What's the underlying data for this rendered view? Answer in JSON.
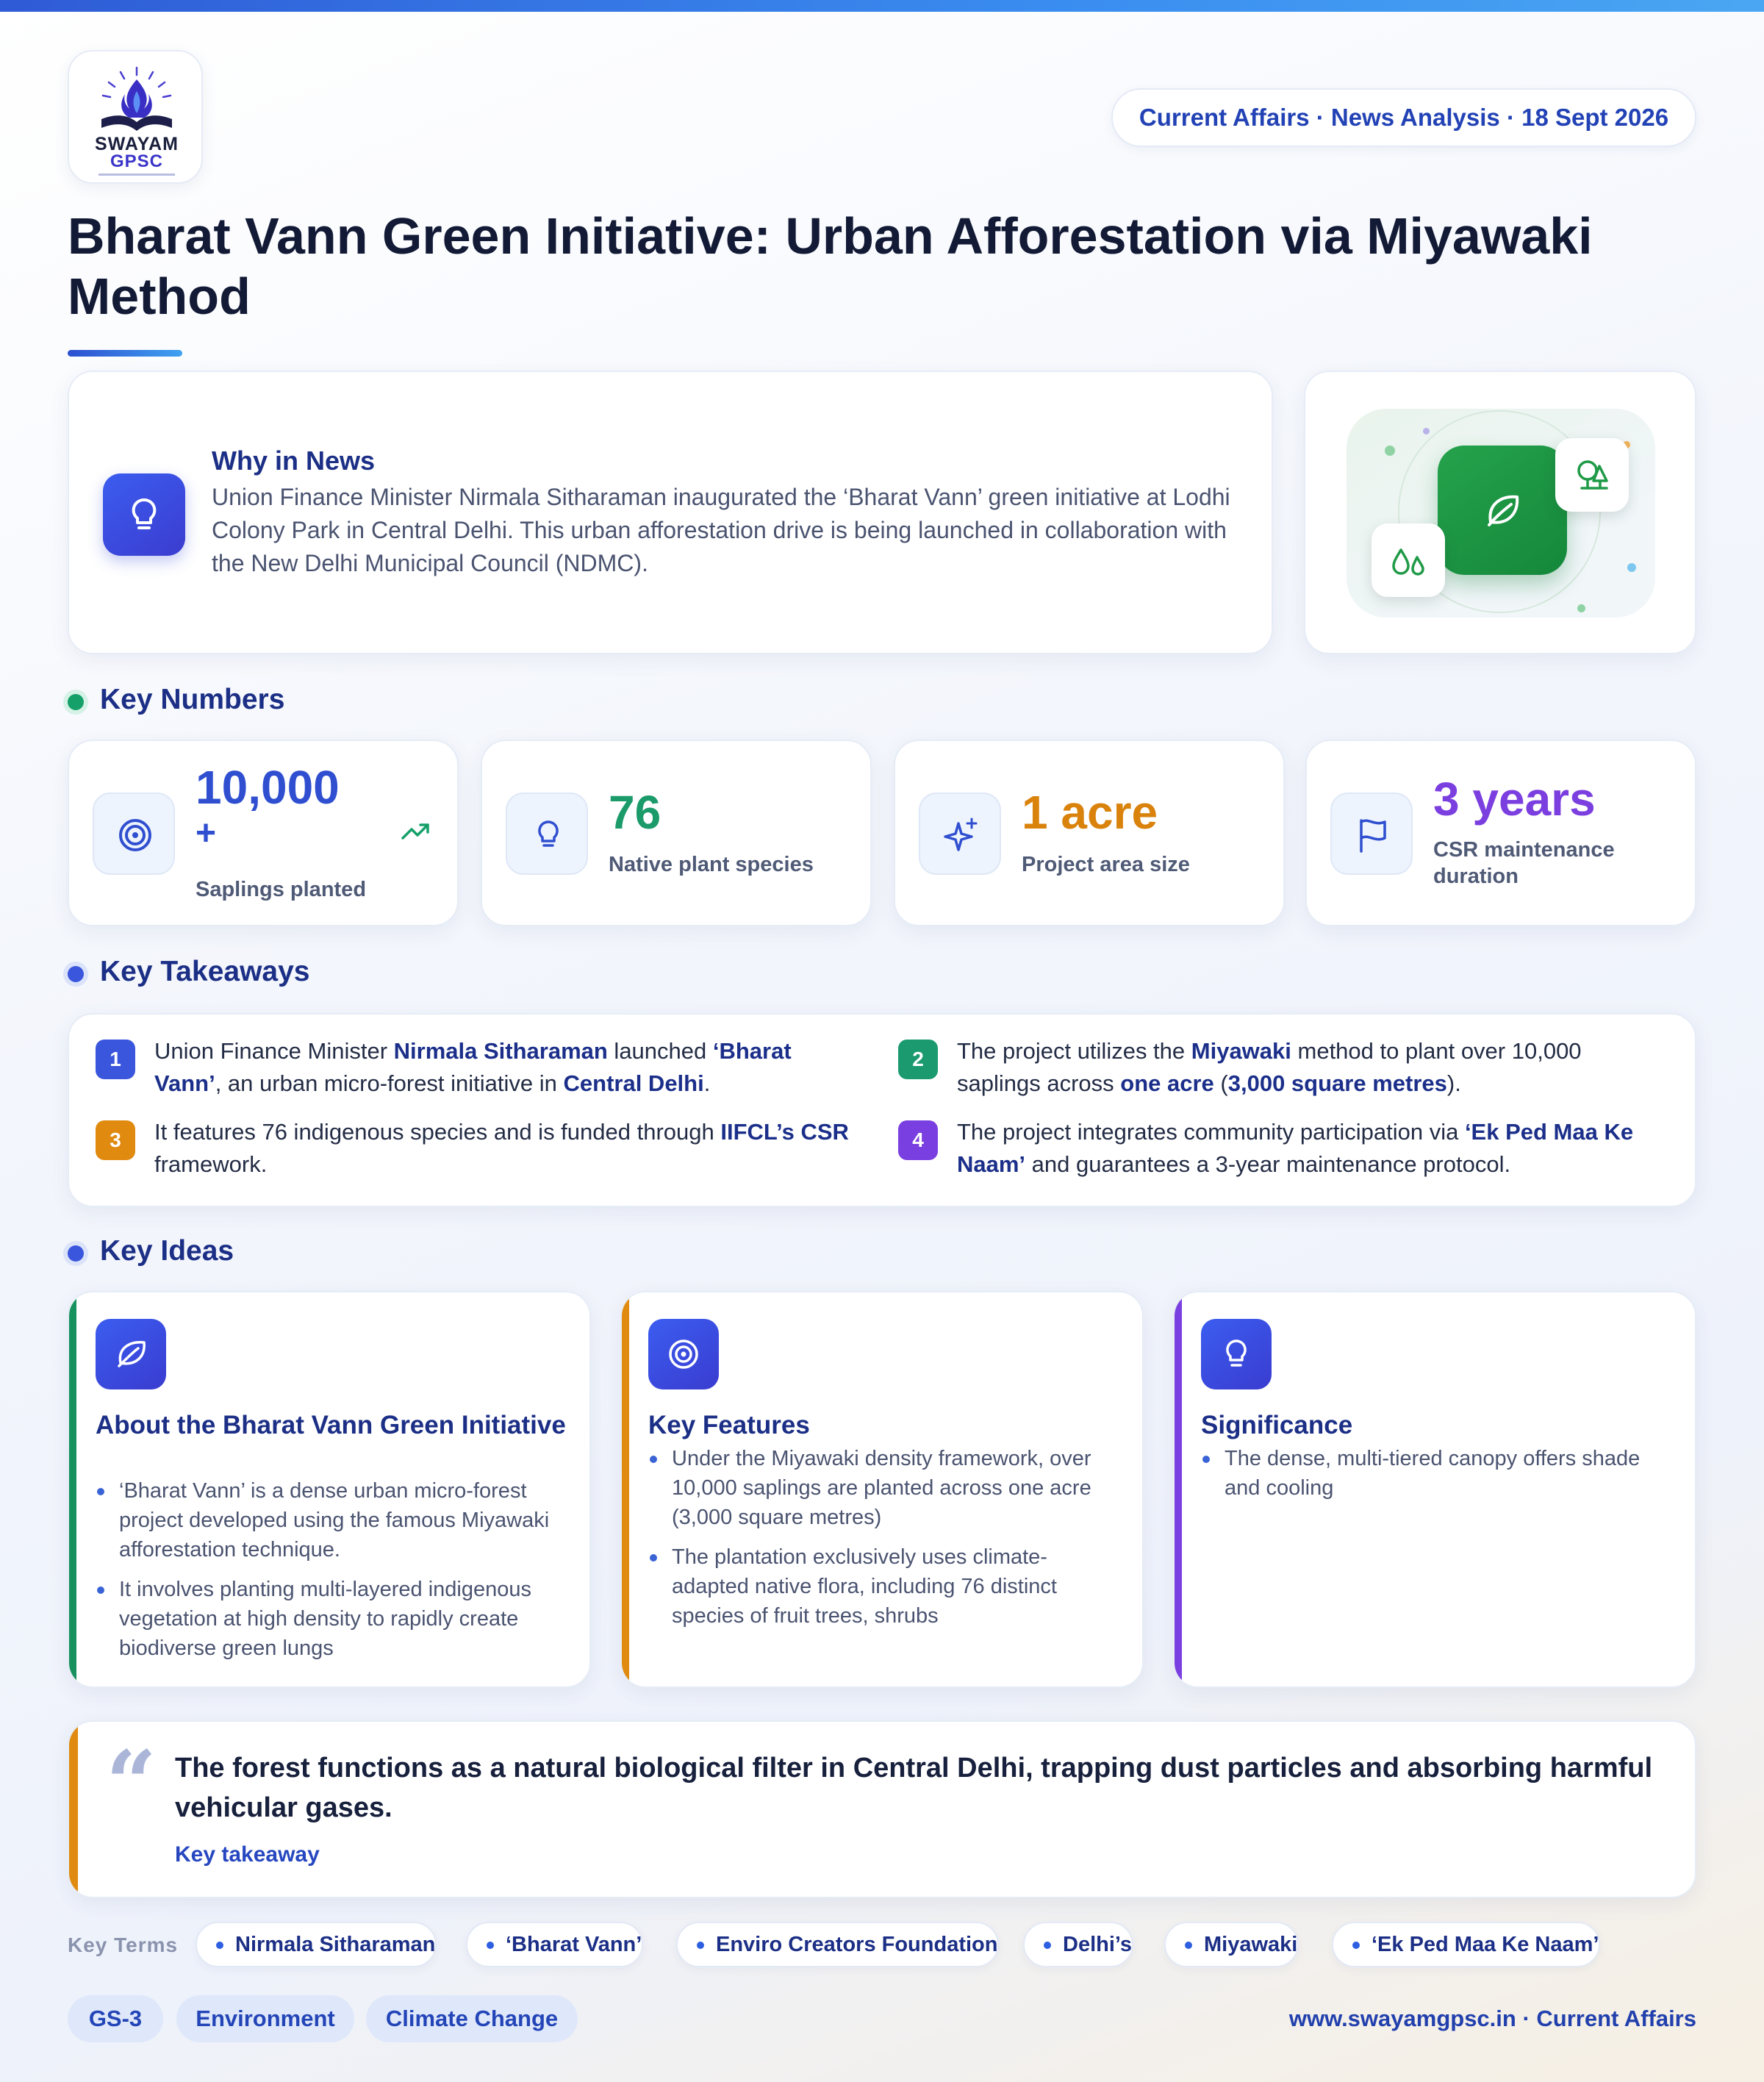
{
  "brand": {
    "line1": "SWAYAM",
    "line2": "GPSC",
    "logo_icon": "book-flame-logo-icon"
  },
  "header": {
    "date_pill": "Current Affairs · News Analysis · 18 Sept 2026",
    "title": "Bharat Vann Green Initiative: Urban Afforestation via Miyawaki Method"
  },
  "why_in_news": {
    "heading": "Why in News",
    "text": "Union Finance Minister Nirmala Sitharaman inaugurated the ‘Bharat Vann’ green initiative at Lodhi Colony Park in Central Delhi. This urban afforestation drive is being launched in collaboration with the New Delhi Municipal Council (NDMC).",
    "icon": "lightbulb-icon"
  },
  "hero": {
    "main_icon": "leaf-icon",
    "chip_icons": [
      "trees-icon",
      "droplets-icon"
    ],
    "accent": "#1f9a47"
  },
  "key_numbers": {
    "heading": "Key Numbers",
    "items": [
      {
        "value": "10,000",
        "value_suffix": "+",
        "label": "Saplings planted",
        "icon": "target-icon",
        "trend_icon": "trending-up-icon",
        "color": "#2f4fd0"
      },
      {
        "value": "76",
        "label": "Native plant species",
        "icon": "lightbulb-icon",
        "color": "#1b9a6a"
      },
      {
        "value": "1 acre",
        "label": "Project area size",
        "icon": "sparkles-icon",
        "color": "#d9820c"
      },
      {
        "value": "3 years",
        "label_line1": "CSR maintenance",
        "label_line2": "duration",
        "icon": "flag-icon",
        "color": "#7b3fe0"
      }
    ]
  },
  "key_takeaways": {
    "heading": "Key Takeaways",
    "items": [
      {
        "num": "1",
        "color": "#3a56dd",
        "parts": [
          [
            "Union Finance Minister ",
            false
          ],
          [
            "Nirmala Sitharaman",
            true
          ],
          [
            " launched ",
            false
          ],
          [
            "‘Bharat Vann’",
            true
          ],
          [
            ", an urban micro-forest initiative in ",
            false
          ],
          [
            "Central Delhi",
            true
          ],
          [
            ".",
            false
          ]
        ]
      },
      {
        "num": "2",
        "color": "#1a9a6e",
        "parts": [
          [
            "The project utilizes the ",
            false
          ],
          [
            "Miyawaki",
            true
          ],
          [
            " method to plant over 10,000 saplings across ",
            false
          ],
          [
            "one acre",
            true
          ],
          [
            " (",
            false
          ],
          [
            "3,000 square metres",
            true
          ],
          [
            ").",
            false
          ]
        ]
      },
      {
        "num": "3",
        "color": "#e08a10",
        "parts": [
          [
            "It features 76 indigenous species and is funded through ",
            false
          ],
          [
            "IIFCL’s CSR",
            true
          ],
          [
            " framework.",
            false
          ]
        ]
      },
      {
        "num": "4",
        "color": "#7a3fe0",
        "parts": [
          [
            "The project integrates community participation via ",
            false
          ],
          [
            "‘Ek Ped Maa Ke Naam’",
            true
          ],
          [
            " and guarantees a 3-year maintenance protocol.",
            false
          ]
        ]
      }
    ]
  },
  "key_ideas": {
    "heading": "Key Ideas",
    "cards": [
      {
        "title": "About the Bharat Vann Green Initiative",
        "icon": "leaf-icon",
        "edge": "#17915d",
        "points": [
          "‘Bharat Vann’ is a dense urban micro-forest project developed using the famous Miyawaki afforestation technique.",
          "It involves planting multi-layered indigenous vegetation at high density to rapidly create biodiverse green lungs"
        ]
      },
      {
        "title": "Key Features",
        "icon": "target-icon",
        "edge": "#e08a10",
        "points": [
          "Under the Miyawaki density framework, over 10,000 saplings are planted across one acre (3,000 square metres)",
          "The plantation exclusively uses climate-adapted native flora, including 76 distinct species of fruit trees, shrubs"
        ]
      },
      {
        "title": "Significance",
        "icon": "lightbulb-icon",
        "edge": "#7a3fe0",
        "points": [
          "The dense, multi-tiered canopy offers shade and cooling"
        ]
      }
    ]
  },
  "quote": {
    "mark": "“",
    "text": "The forest functions as a natural biological filter in Central Delhi, trapping dust particles and absorbing harmful vehicular gases.",
    "label": "Key takeaway"
  },
  "key_terms": {
    "label": "Key Terms",
    "items": [
      "Nirmala Sitharaman",
      "‘Bharat Vann’",
      "Enviro Creators Foundation",
      "Delhi’s",
      "Miyawaki",
      "‘Ek Ped Maa Ke Naam’"
    ]
  },
  "tags": [
    "GS-3",
    "Environment",
    "Climate Change"
  ],
  "footer": "www.swayamgpsc.in · Current Affairs"
}
